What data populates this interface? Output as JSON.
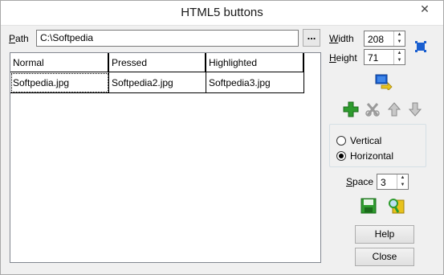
{
  "window": {
    "title": "HTML5 buttons",
    "close_glyph": "✕"
  },
  "path": {
    "label_first": "P",
    "label_rest": "ath",
    "value": "C:\\Softpedia",
    "browse_label": "..."
  },
  "grid": {
    "columns": [
      "Normal",
      "Pressed",
      "Highlighted"
    ],
    "rows": [
      [
        "Softpedia.jpg",
        "Softpedia2.jpg",
        "Softpedia3.jpg"
      ]
    ]
  },
  "size": {
    "width_label_first": "W",
    "width_label_rest": "idth",
    "width_value": "208",
    "height_label_first": "H",
    "height_label_rest": "eight",
    "height_value": "71"
  },
  "orientation": {
    "options": [
      "Vertical",
      "Horizontal"
    ],
    "selected": "Horizontal"
  },
  "space": {
    "label_first": "S",
    "label_rest": "pace",
    "value": "3"
  },
  "buttons": {
    "help": "Help",
    "close": "Close"
  },
  "icons": [
    "fit-image-icon",
    "import-icon",
    "add-icon",
    "delete-icon",
    "move-up-icon",
    "move-down-icon",
    "save-icon",
    "preview-icon"
  ],
  "colors": {
    "accent_blue": "#1a5fd0",
    "green": "#2e9b2e",
    "yellow": "#e8c21c",
    "gray_icon": "#9a9a9a"
  }
}
